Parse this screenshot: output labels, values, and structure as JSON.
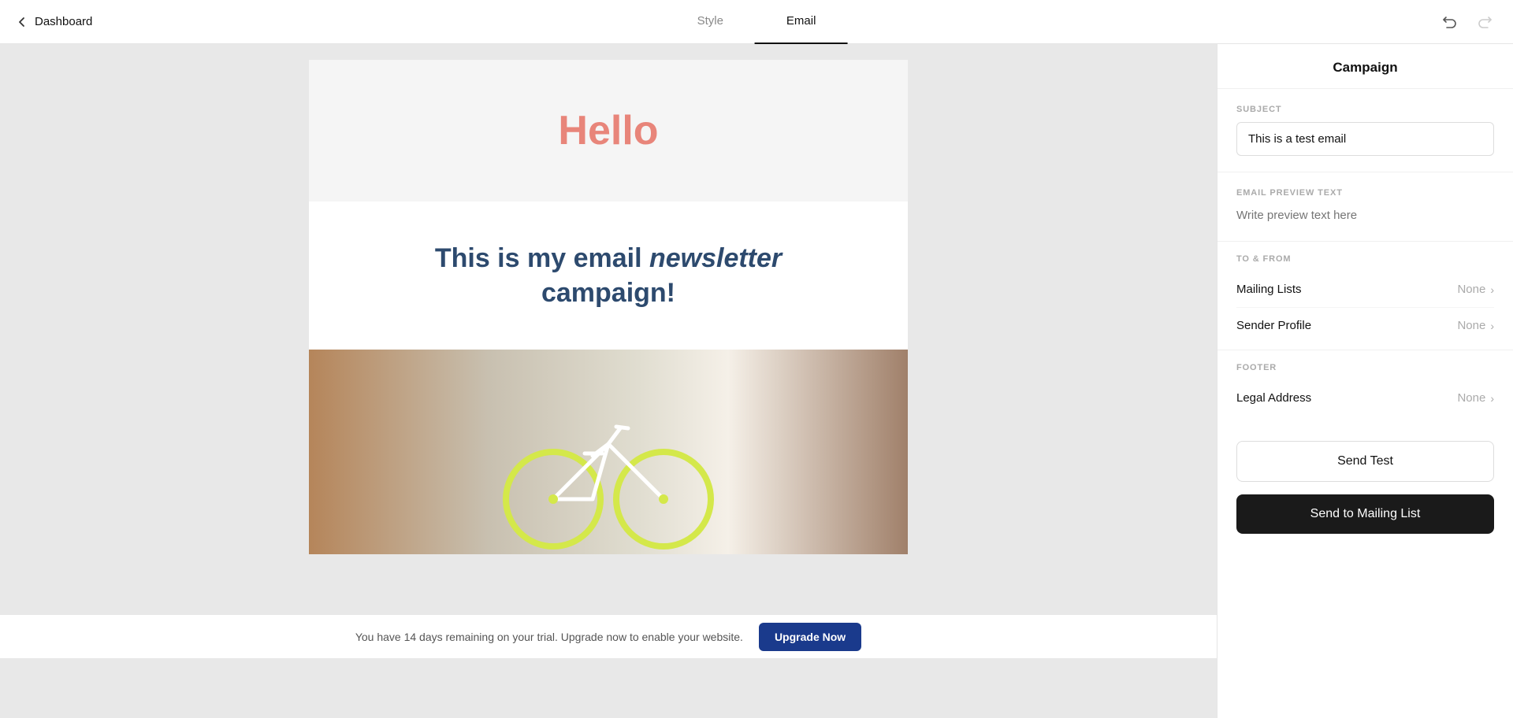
{
  "topbar": {
    "back_label": "Dashboard",
    "tab_style": "Style",
    "tab_email": "Email",
    "active_tab": "Email"
  },
  "campaign": {
    "title": "Campaign",
    "subject_label": "SUBJECT",
    "subject_value": "This is a test email",
    "preview_text_label": "EMAIL PREVIEW TEXT",
    "preview_text_placeholder": "Write preview text here",
    "to_from_label": "TO & FROM",
    "mailing_lists_label": "Mailing Lists",
    "mailing_lists_value": "None",
    "sender_profile_label": "Sender Profile",
    "sender_profile_value": "None",
    "footer_label": "FOOTER",
    "legal_address_label": "Legal Address",
    "legal_address_value": "None",
    "send_test_label": "Send Test",
    "send_to_list_label": "Send to Mailing List"
  },
  "email_preview": {
    "hello_text": "Hello",
    "headline_text_1": "This is my email ",
    "headline_italic": "newsletter",
    "headline_text_2": " campaign!"
  },
  "trial_bar": {
    "message": "You have 14 days remaining on your trial. Upgrade now to enable your website.",
    "upgrade_label": "Upgrade Now"
  }
}
